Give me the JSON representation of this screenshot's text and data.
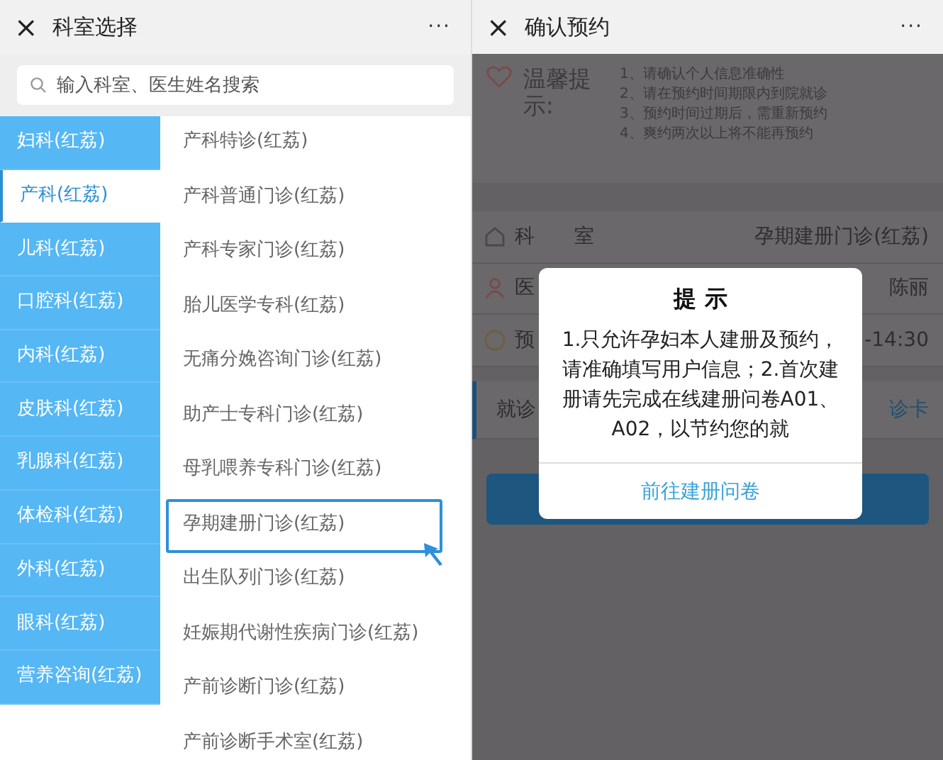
{
  "left_screen": {
    "header": {
      "close": "×",
      "title": "科室选择",
      "more": "···"
    },
    "search": {
      "placeholder": "输入科室、医生姓名搜索"
    },
    "departments": [
      {
        "label": "妇科(红荔)",
        "selected": false
      },
      {
        "label": "产科(红荔)",
        "selected": true
      },
      {
        "label": "儿科(红荔)",
        "selected": false
      },
      {
        "label": "口腔科(红荔)",
        "selected": false
      },
      {
        "label": "内科(红荔)",
        "selected": false
      },
      {
        "label": "皮肤科(红荔)",
        "selected": false
      },
      {
        "label": "乳腺科(红荔)",
        "selected": false
      },
      {
        "label": "体检科(红荔)",
        "selected": false
      },
      {
        "label": "外科(红荔)",
        "selected": false
      },
      {
        "label": "眼科(红荔)",
        "selected": false
      },
      {
        "label": "营养咨询(红荔)",
        "selected": false
      }
    ],
    "clinics": [
      {
        "label": "产科特诊(红荔)",
        "selected": false
      },
      {
        "label": "产科普通门诊(红荔)",
        "selected": false
      },
      {
        "label": "产科专家门诊(红荔)",
        "selected": false
      },
      {
        "label": "胎儿医学专科(红荔)",
        "selected": false
      },
      {
        "label": "无痛分娩咨询门诊(红荔)",
        "selected": false
      },
      {
        "label": "助产士专科门诊(红荔)",
        "selected": false
      },
      {
        "label": "母乳喂养专科门诊(红荔)",
        "selected": false
      },
      {
        "label": "孕期建册门诊(红荔)",
        "selected": true
      },
      {
        "label": "出生队列门诊(红荔)",
        "selected": false
      },
      {
        "label": "妊娠期代谢性疾病门诊(红荔)",
        "selected": false
      },
      {
        "label": "产前诊断门诊(红荔)",
        "selected": false
      },
      {
        "label": "产前诊断手术室(红荔)",
        "selected": false
      }
    ]
  },
  "right_screen": {
    "header": {
      "close": "×",
      "title": "确认预约",
      "more": "···"
    },
    "tips": {
      "title": "温馨提示:",
      "items": [
        "1、请确认个人信息准确性",
        "2、请在预约时间期限内到院就诊",
        "3、预约时间过期后，需重新预约",
        "4、爽约两次以上将不能再预约"
      ]
    },
    "rows": [
      {
        "kind": "department",
        "label": "科　　室",
        "value": "孕期建册门诊(红荔)"
      },
      {
        "kind": "doctor",
        "label": "医",
        "value": "陈丽"
      },
      {
        "kind": "time",
        "label": "预",
        "value": "-14:30"
      }
    ],
    "card_row": {
      "label": "就诊",
      "value": "诊卡"
    },
    "dialog": {
      "title": "提 示",
      "message": "1.只允许孕妇本人建册及预约，请准确填写用户信息；2.首次建册请先完成在线建册问卷A01、A02，以节约您的就",
      "action": "前往建册问卷"
    }
  }
}
